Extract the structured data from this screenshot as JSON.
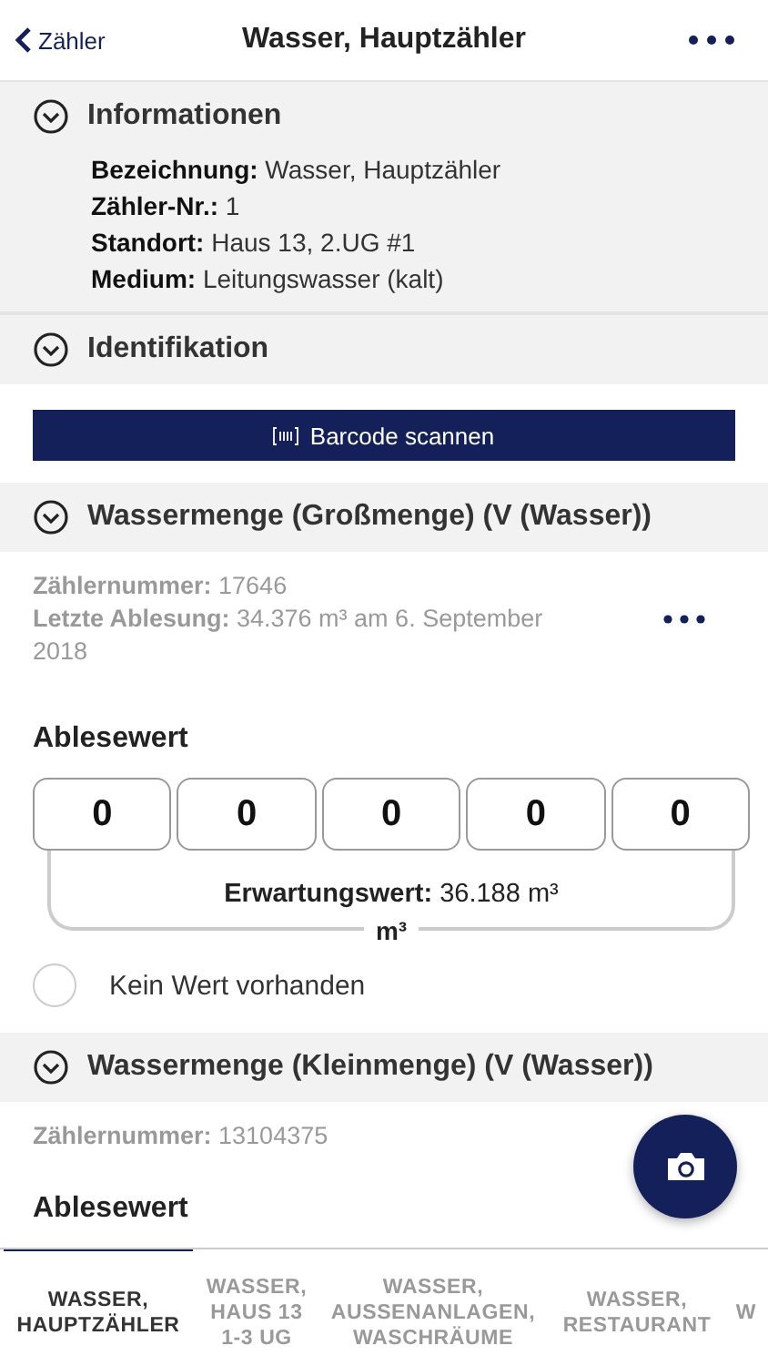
{
  "nav": {
    "back": "Zähler",
    "title": "Wasser, Hauptzähler"
  },
  "info_section": {
    "title": "Informationen",
    "expanded": true,
    "fields": [
      {
        "label": "Bezeichnung:",
        "value": "Wasser, Hauptzähler"
      },
      {
        "label": "Zähler-Nr.:",
        "value": "1"
      },
      {
        "label": "Standort:",
        "value": "Haus 13, 2.UG #1"
      },
      {
        "label": "Medium:",
        "value": "Leitungswasser (kalt)"
      }
    ]
  },
  "ident_section": {
    "title": "Identifikation",
    "expanded": true,
    "button": "Barcode scannen"
  },
  "meters": [
    {
      "title": "Wassermenge (Großmenge) (V (Wasser))",
      "expanded": true,
      "fields": [
        {
          "label": "Zählernummer:",
          "value": "17646"
        },
        {
          "label": "Letzte Ablesung:",
          "value": "34.376 m³ am 6. September 2018"
        }
      ],
      "reading_title": "Ablesewert",
      "digits": [
        "0",
        "0",
        "0",
        "0",
        "0"
      ],
      "expected_label": "Erwartungswert:",
      "expected_value": "36.188 m³",
      "unit": "m³",
      "no_value": {
        "label": "Kein Wert vorhanden",
        "checked": false
      }
    },
    {
      "title": "Wassermenge (Kleinmenge) (V (Wasser))",
      "expanded": true,
      "fields": [
        {
          "label": "Zählernummer:",
          "value": "13104375"
        }
      ],
      "reading_title": "Ablesewert"
    }
  ],
  "tabs": [
    {
      "label": "WASSER, HAUPTZÄHLER",
      "selected": true
    },
    {
      "label": "WASSER, HAUS 13 1-3 UG",
      "selected": false
    },
    {
      "label": "WASSER, AUSSENANLAGEN, WASCHRÄUME",
      "selected": false
    },
    {
      "label": "WASSER, RESTAURANT",
      "selected": false
    },
    {
      "label": "W",
      "selected": false
    }
  ]
}
